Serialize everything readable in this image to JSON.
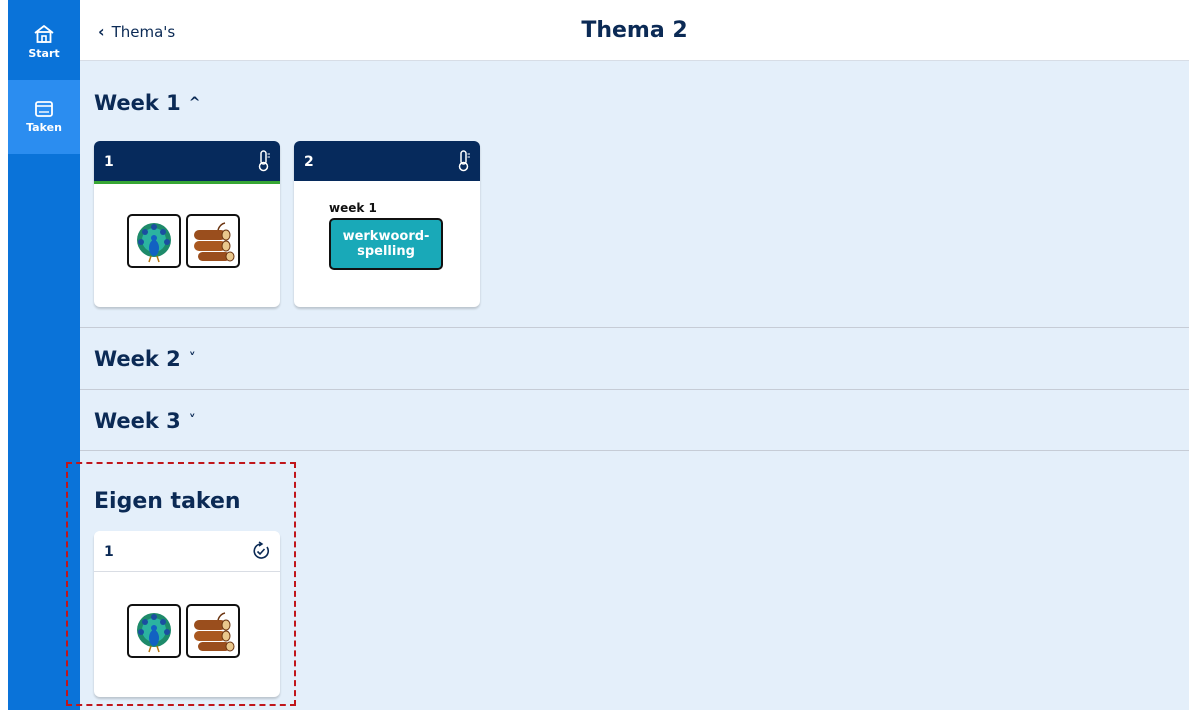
{
  "sidebar": {
    "items": [
      {
        "label": "Start",
        "icon": "home-icon"
      },
      {
        "label": "Taken",
        "icon": "window-icon"
      }
    ]
  },
  "header": {
    "back_label": "Thema's",
    "title": "Thema 2"
  },
  "weeks": [
    {
      "label": "Week 1",
      "expanded": true
    },
    {
      "label": "Week 2",
      "expanded": false
    },
    {
      "label": "Week 3",
      "expanded": false
    }
  ],
  "week1_tasks": [
    {
      "number": "1",
      "icon": "thermometer-icon",
      "progress_color": "#37a634",
      "pictograms": [
        "peacock-icon",
        "logs-icon"
      ]
    },
    {
      "number": "2",
      "icon": "thermometer-icon",
      "week_label": "week 1",
      "chip_label": "werkwoord-\nspelling"
    }
  ],
  "eigen": {
    "title": "Eigen taken",
    "tasks": [
      {
        "number": "1",
        "icon": "refresh-check-icon",
        "pictograms": [
          "peacock-icon",
          "logs-icon"
        ]
      }
    ]
  },
  "colors": {
    "sidebar": "#0a73d9",
    "sidebar_active": "#2b8df0",
    "card_header": "#062a5c",
    "main_bg": "#e4effa",
    "chip": "#19a9b8",
    "highlight": "#c0161b"
  }
}
